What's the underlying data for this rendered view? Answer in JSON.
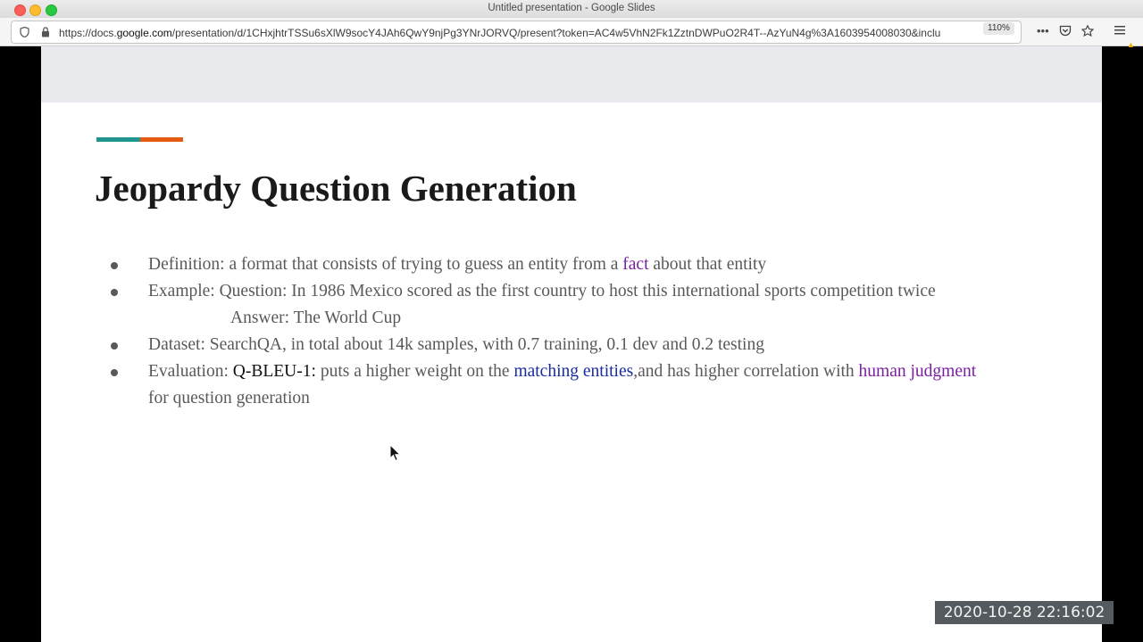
{
  "window": {
    "title": "Untitled presentation - Google Slides"
  },
  "urlbar": {
    "url_prefix": "https://docs.",
    "url_host": "google.com",
    "url_rest": "/presentation/d/1CHxjhtrTSSu6sXlW9socY4JAh6QwY9njPg3YNrJORVQ/present?token=AC4w5VhN2Fk1ZztnDWPuO2R4T--AzYuN4g%3A1603954008030&inclu",
    "zoom": "110%",
    "icons": [
      "shield-icon",
      "lock-icon",
      "more-icon",
      "pocket-icon",
      "star-icon",
      "menu-icon",
      "warning-icon"
    ]
  },
  "slide": {
    "title": "Jeopardy Question Generation",
    "accent_colors": [
      "#20958f",
      "#e35a12"
    ],
    "bullets": {
      "definition_prefix": "Definition: a format that consists of trying to guess an entity from a ",
      "definition_link": "fact",
      "definition_suffix": " about that entity",
      "example_text": "Example: Question: In 1986 Mexico scored as the first country to host this international sports competition twice",
      "answer_text": "Answer: The World Cup",
      "dataset_text": "Dataset: SearchQA, in total about 14k samples, with 0.7 training, 0.1 dev and 0.2 testing",
      "evaluation_prefix": "Evaluation: ",
      "evaluation_metric": "Q-BLEU-1:",
      "evaluation_mid": " puts a higher weight on the ",
      "evaluation_link1": "matching entities",
      "evaluation_mid2": ",and has higher correlation with ",
      "evaluation_link2": "human judgment",
      "evaluation_suffix": " for question generation"
    }
  },
  "overlay": {
    "timestamp": "2020-10-28  22:16:02"
  }
}
